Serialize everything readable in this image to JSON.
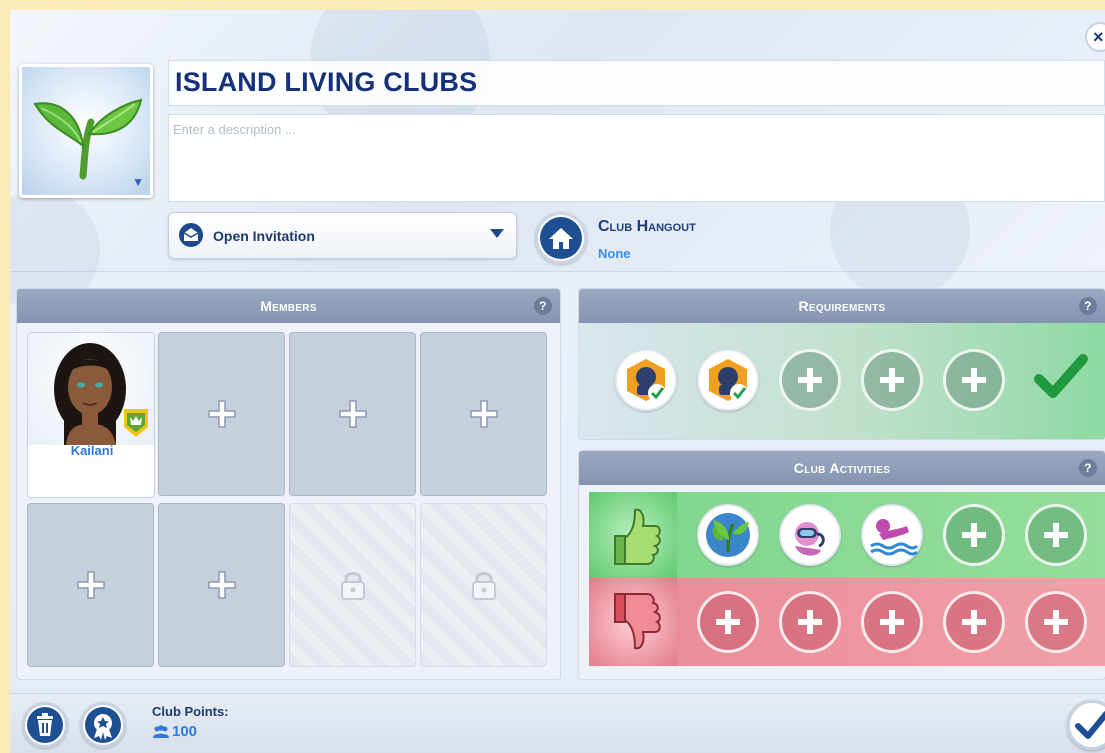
{
  "club": {
    "name": "ISLAND LIVING CLUBS",
    "description_placeholder": "Enter a description ...",
    "description_value": ""
  },
  "invitation": {
    "selected": "Open Invitation"
  },
  "hangout": {
    "title": "Club Hangout",
    "value": "None"
  },
  "members": {
    "header": "Members",
    "help": "?",
    "filled": [
      {
        "name": "Kailani"
      }
    ],
    "open_slots": 5,
    "locked_slots": 2
  },
  "requirements": {
    "header": "Requirements",
    "help": "?",
    "set_count": 2,
    "empty_count": 3
  },
  "activities": {
    "header": "Club Activities",
    "help": "?",
    "liked_count": 3,
    "liked_empty": 2,
    "disliked_empty": 5
  },
  "footer": {
    "points_label": "Club Points:",
    "points_value": "100"
  },
  "colors": {
    "brand_navy": "#17307a",
    "accent_blue": "#2f7ad6",
    "like_green": "#7ed68c",
    "dislike_red": "#e98995"
  }
}
